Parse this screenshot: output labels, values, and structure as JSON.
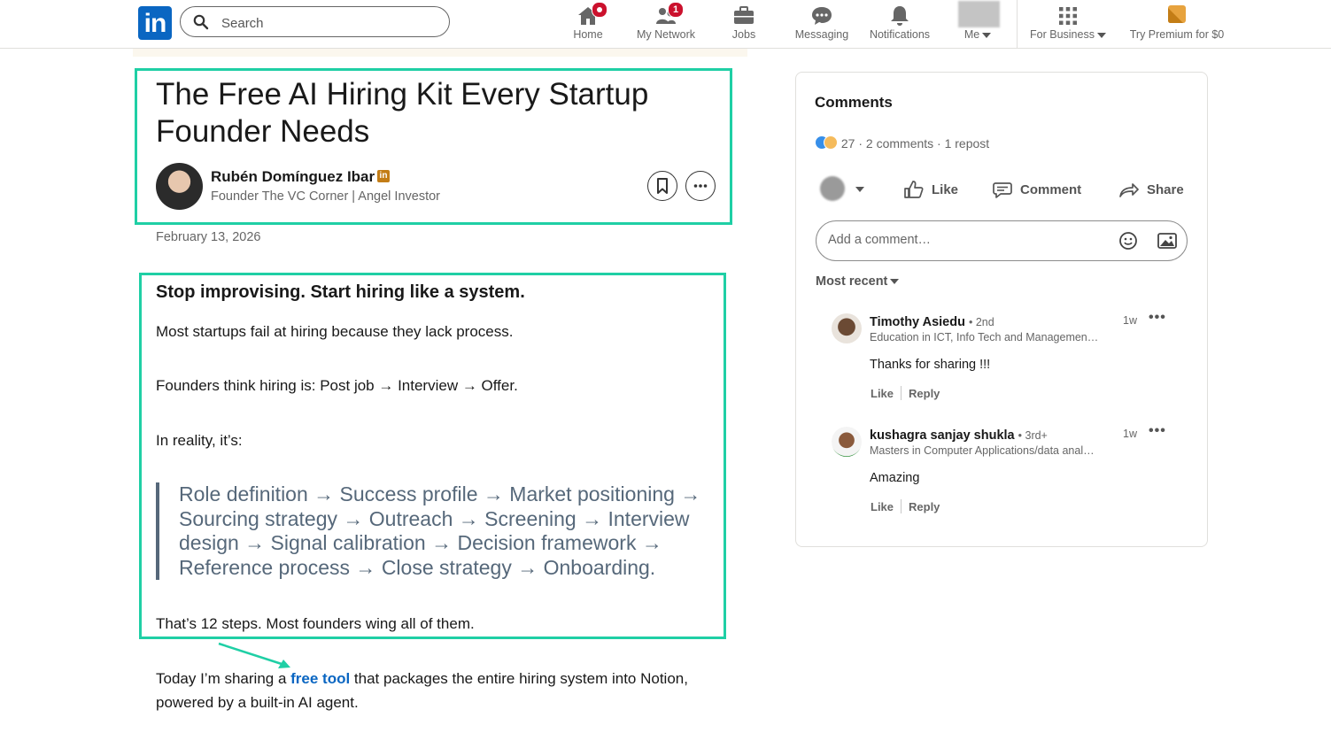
{
  "nav": {
    "search_placeholder": "Search",
    "items": [
      {
        "label": "Home",
        "icon": "home-icon",
        "badge": ""
      },
      {
        "label": "My Network",
        "icon": "network-icon",
        "badge": "1"
      },
      {
        "label": "Jobs",
        "icon": "briefcase-icon",
        "badge": ""
      },
      {
        "label": "Messaging",
        "icon": "message-icon",
        "badge": ""
      },
      {
        "label": "Notifications",
        "icon": "bell-icon",
        "badge": ""
      },
      {
        "label": "Me",
        "icon": "avatar"
      },
      {
        "label": "For Business",
        "icon": "grid-icon"
      },
      {
        "label": "Try Premium for $0",
        "icon": "premium-icon"
      }
    ],
    "logo_text": "in"
  },
  "article": {
    "title": "The Free AI Hiring Kit Every Startup Founder Needs",
    "author_name": "Rubén Domínguez Ibar",
    "author_badge": "in",
    "author_headline": "Founder The VC Corner | Angel Investor",
    "date": "February 13, 2026",
    "subhead": "Stop improvising. Start hiring like a system.",
    "p1": "Most startups fail at hiring because they lack process.",
    "p2": "Founders think hiring is: Post job → Interview → Offer.",
    "p3": "In reality, it’s:",
    "quote": "Role definition → Success profile → Market positioning → Sourcing strategy → Outreach → Screening → Interview design → Signal calibration → Decision framework → Reference process → Close strategy → Onboarding.",
    "p4": "That’s 12 steps. Most founders wing all of them.",
    "p5_before": "Today I’m sharing a ",
    "p5_link": "free tool",
    "p5_after": " that packages the entire hiring system into Notion, powered by a built-in AI agent.",
    "accent_color": "#1fcfa5"
  },
  "comments": {
    "title": "Comments",
    "reactions_summary": "27 · 2 comments · 1 repost",
    "actions": {
      "like": "Like",
      "comment": "Comment",
      "share": "Share"
    },
    "input_placeholder": "Add a comment…",
    "sort_label": "Most recent",
    "list": [
      {
        "name": "Timothy Asiedu",
        "degree": "• 2nd",
        "headline": "Education in ICT, Info Tech and Managemen…",
        "time": "1w",
        "text": "Thanks for sharing !!!",
        "like": "Like",
        "reply": "Reply"
      },
      {
        "name": "kushagra sanjay shukla",
        "degree": "• 3rd+",
        "headline": "Masters in Computer Applications/data anal…",
        "time": "1w",
        "text": "Amazing",
        "like": "Like",
        "reply": "Reply"
      }
    ]
  }
}
